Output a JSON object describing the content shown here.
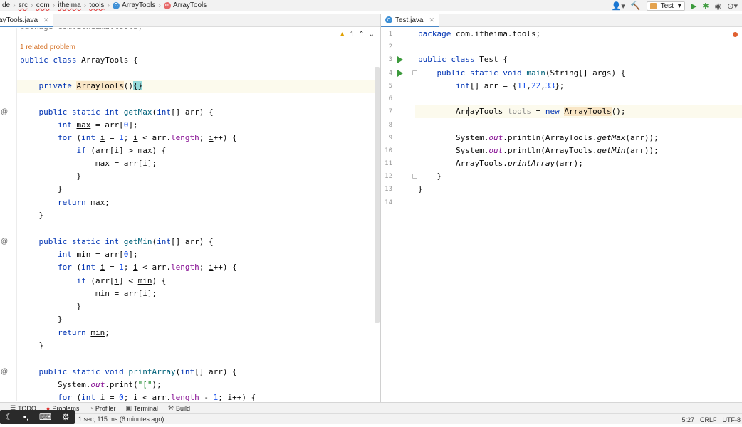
{
  "breadcrumb": {
    "items": [
      "de",
      "src",
      "com",
      "itheima",
      "tools",
      "ArrayTools",
      "ArrayTools"
    ]
  },
  "toolbar": {
    "run_config": "Test"
  },
  "tabs": {
    "left": "ayTools.java",
    "right": "Test.java"
  },
  "left_editor": {
    "top_cut": "package com.itheima.tools;",
    "related_problems": "1 related problem",
    "warning_count": "1",
    "lines": [
      "public class ArrayTools {",
      "",
      "    private ArrayTools(){}",
      "",
      "    public static int getMax(int[] arr) {",
      "        int max = arr[0];",
      "        for (int i = 1; i < arr.length; i++) {",
      "            if (arr[i] > max) {",
      "                max = arr[i];",
      "            }",
      "        }",
      "        return max;",
      "    }",
      "",
      "    public static int getMin(int[] arr) {",
      "        int min = arr[0];",
      "        for (int i = 1; i < arr.length; i++) {",
      "            if (arr[i] < min) {",
      "                min = arr[i];",
      "            }",
      "        }",
      "        return min;",
      "    }",
      "",
      "    public static void printArray(int[] arr) {",
      "        System.out.print(\"[\");",
      "        for (int i = 0; i < arr.length - 1; i++) {"
    ]
  },
  "right_editor": {
    "line_numbers": [
      "1",
      "2",
      "3",
      "4",
      "5",
      "6",
      "7",
      "8",
      "9",
      "10",
      "11",
      "12",
      "13",
      "14"
    ],
    "lines": [
      "package com.itheima.tools;",
      "",
      "public class Test {",
      "    public static void main(String[] args) {",
      "        int[] arr = {11,22,33};",
      "",
      "        ArrayTools tools = new ArrayTools();",
      "",
      "        System.out.println(ArrayTools.getMax(arr));",
      "        System.out.println(ArrayTools.getMin(arr));",
      "        ArrayTools.printArray(arr);",
      "    }",
      "}",
      ""
    ]
  },
  "bottom_tools": {
    "todo": "TODO",
    "problems": "Problems",
    "profiler": "Profiler",
    "terminal": "Terminal",
    "build": "Build"
  },
  "status": {
    "message": "1 sec, 115 ms (6 minutes ago)",
    "position": "5:27",
    "line_sep": "CRLF",
    "encoding": "UTF-8"
  },
  "icons": {
    "class": "class-icon",
    "method": "method-icon",
    "run": "run-gutter-icon",
    "warning": "warning-icon"
  },
  "colors": {
    "keyword": "#0033b3",
    "number": "#1750eb",
    "field": "#871094",
    "method_call": "#00627a",
    "string": "#067d17",
    "related_problem": "#d6742a"
  }
}
